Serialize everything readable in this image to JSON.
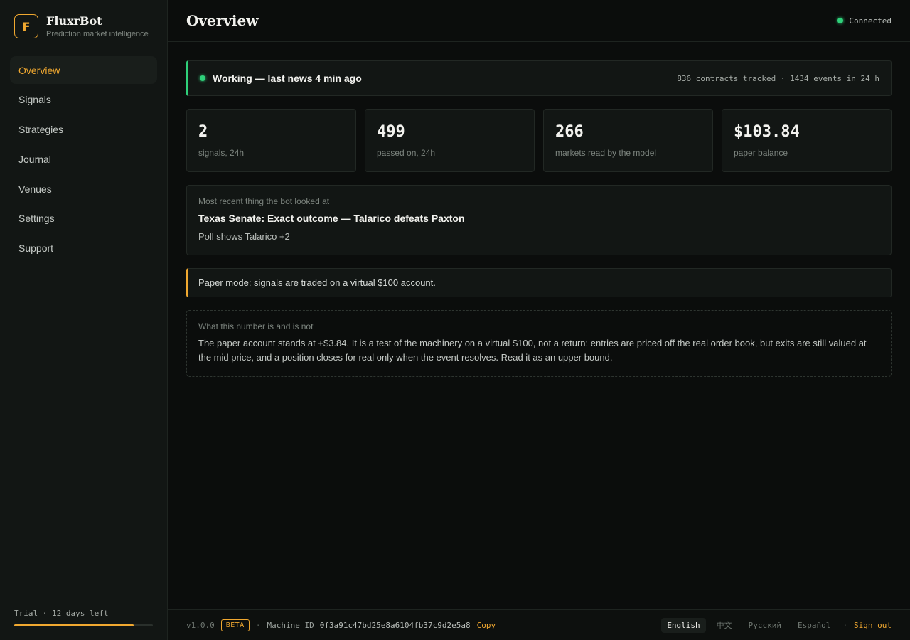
{
  "brand": {
    "logo_letter": "F",
    "name": "FluxrBot",
    "tagline": "Prediction market intelligence"
  },
  "nav": {
    "items": [
      {
        "label": "Overview",
        "active": true
      },
      {
        "label": "Signals",
        "active": false
      },
      {
        "label": "Strategies",
        "active": false
      },
      {
        "label": "Journal",
        "active": false
      },
      {
        "label": "Venues",
        "active": false
      },
      {
        "label": "Settings",
        "active": false
      },
      {
        "label": "Support",
        "active": false
      }
    ]
  },
  "trial": {
    "label": "Trial · 12 days left",
    "progress_fraction": 0.86
  },
  "header": {
    "title": "Overview",
    "connection": "Connected"
  },
  "status": {
    "text": "Working — last news 4 min ago",
    "summary": "836 contracts tracked · 1434 events in 24 h"
  },
  "stats": [
    {
      "value": "2",
      "label": "signals, 24h"
    },
    {
      "value": "499",
      "label": "passed on, 24h"
    },
    {
      "value": "266",
      "label": "markets read by the model"
    },
    {
      "value": "$103.84",
      "label": "paper balance"
    }
  ],
  "recent": {
    "label": "Most recent thing the bot looked at",
    "title": "Texas Senate: Exact outcome — Talarico defeats Paxton",
    "detail": "Poll shows Talarico +2"
  },
  "paper_notice": "Paper mode: signals are traded on a virtual $100 account.",
  "explainer": {
    "label": "What this number is and is not",
    "text": "The paper account stands at +$3.84. It is a test of the machinery on a virtual $100, not a return: entries are priced off the real order book, but exits are still valued at the mid price, and a position closes for real only when the event resolves. Read it as an upper bound."
  },
  "footer": {
    "version": "v1.0.0",
    "badge": "BETA",
    "separator": "·",
    "machine_id_label": "Machine ID",
    "machine_id": "0f3a91c47bd25e8a6104fb37c9d2e5a8",
    "copy_label": "Copy",
    "languages": [
      {
        "label": "English",
        "active": true
      },
      {
        "label": "中文",
        "active": false
      },
      {
        "label": "Русский",
        "active": false
      },
      {
        "label": "Español",
        "active": false
      }
    ],
    "sign_out": "Sign out"
  },
  "colors": {
    "accent": "#f0a830",
    "success": "#2fd07a",
    "background": "#0b0d0c",
    "panel": "#121614"
  }
}
